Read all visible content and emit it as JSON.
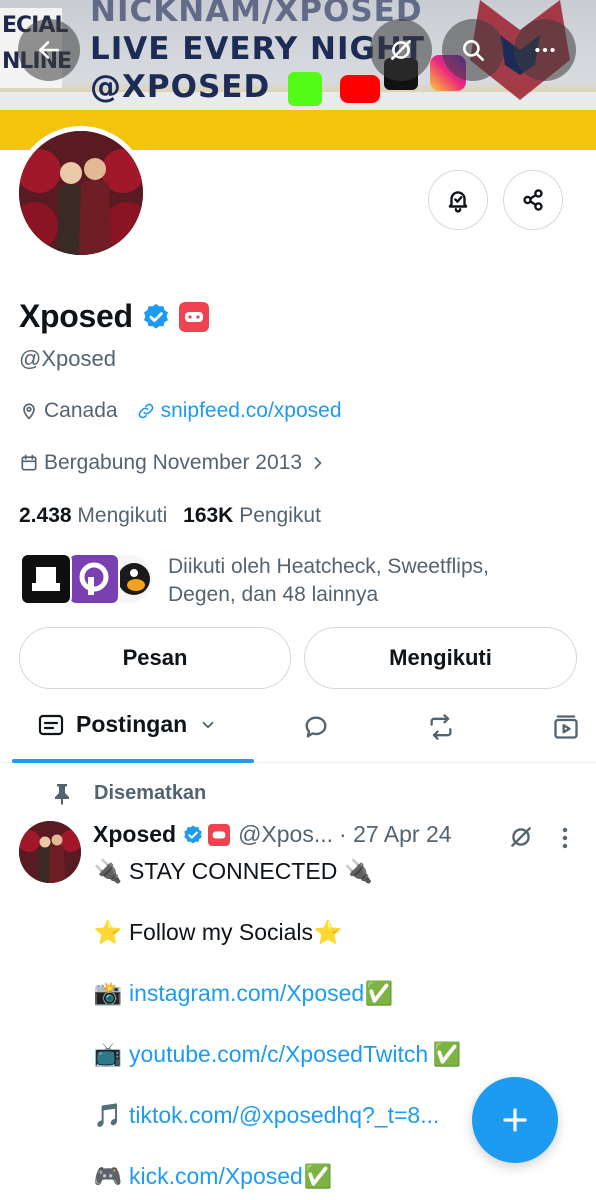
{
  "banner": {
    "left_text": [
      "ECIAL",
      "NLINE"
    ],
    "rows": [
      "NICKNAM/XPOSED",
      "LIVE EVERY NIGHT",
      "@XPOSED"
    ]
  },
  "profile": {
    "name": "Xposed",
    "handle": "@Xposed",
    "location": "Canada",
    "website": "snipfeed.co/xposed",
    "joined": "Bergabung November 2013",
    "following_count": "2.438",
    "following_label": "Mengikuti",
    "followers_count": "163K",
    "followers_label": "Pengikut",
    "followed_by": "Diikuti oleh Heatcheck, Sweetflips, Degen, dan 48 lainnya"
  },
  "buttons": {
    "message": "Pesan",
    "following": "Mengikuti"
  },
  "tabs": {
    "posts": "Postingan"
  },
  "post": {
    "pinned_label": "Disematkan",
    "name": "Xposed",
    "handle": "@Xpos...",
    "date": "· 27 Apr 24",
    "lines": [
      {
        "emoji": "🔌",
        "text": "STAY CONNECTED",
        "emoji_after": "🔌",
        "link": false
      },
      {
        "emoji": "⭐",
        "text": "Follow my Socials",
        "emoji_after": "⭐",
        "link": false
      },
      {
        "emoji": "📸",
        "text": "instagram.com/Xposed",
        "emoji_after": "✅",
        "link": true
      },
      {
        "emoji": "📺",
        "text": "youtube.com/c/XposedTwitch",
        "emoji_after": "✅",
        "link": true
      },
      {
        "emoji": "🎵",
        "text": "tiktok.com/@xposedhq?_t=8...",
        "emoji_after": "",
        "link": true
      },
      {
        "emoji": "🎮",
        "text": "kick.com/Xposed",
        "emoji_after": "✅",
        "link": true
      }
    ]
  },
  "colors": {
    "accent": "#1d9bf0",
    "muted": "#536471",
    "affiliate": "#f04352"
  }
}
